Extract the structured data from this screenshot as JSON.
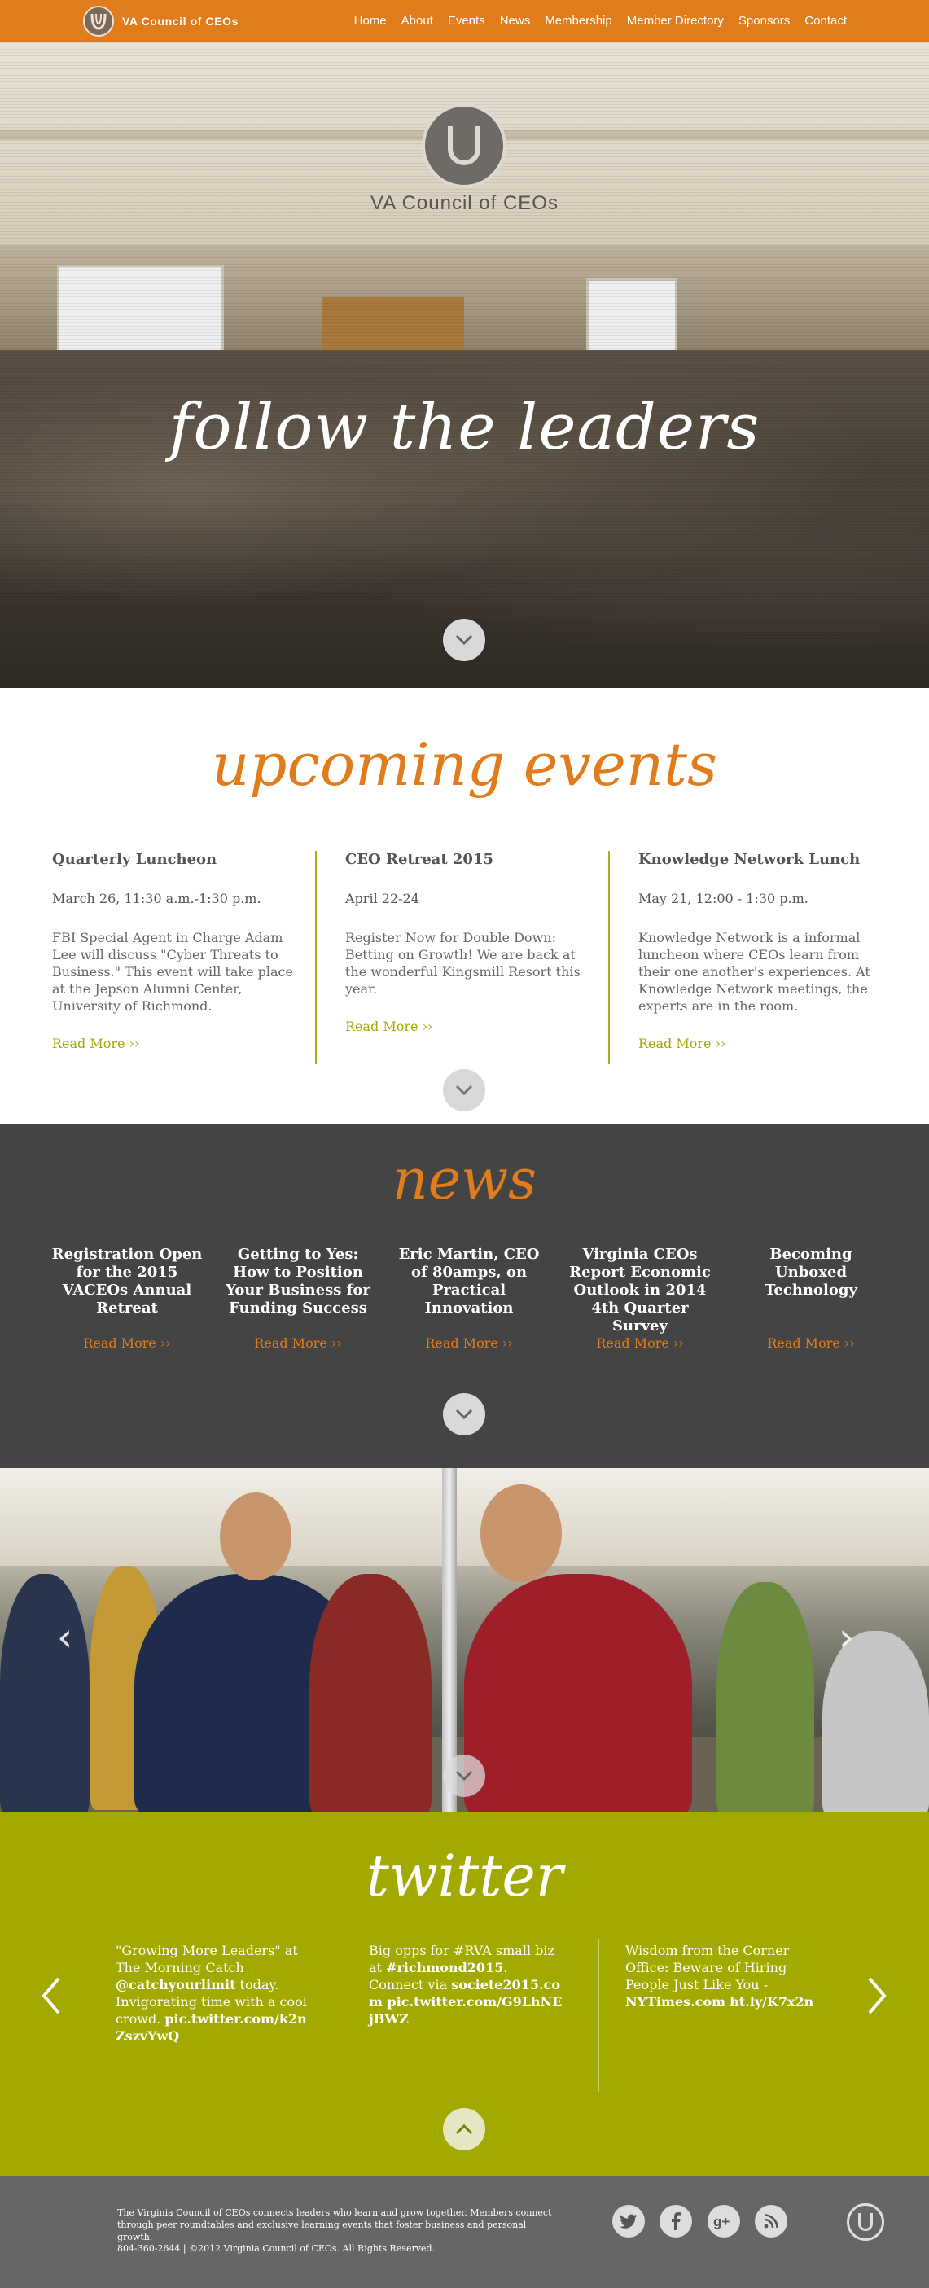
{
  "nav": {
    "brand": "VA Council of CEOs",
    "items": [
      "Home",
      "About",
      "Events",
      "News",
      "Membership",
      "Member Directory",
      "Sponsors",
      "Contact"
    ]
  },
  "hero": {
    "brand": "VA Council of CEOs",
    "tagline": "follow the leaders"
  },
  "events": {
    "title": "upcoming events",
    "items": [
      {
        "title": "Quarterly Luncheon",
        "date": "March 26, 11:30 a.m.-1:30 p.m.",
        "desc": "FBI Special Agent in Charge Adam Lee will discuss \"Cyber Threats to Business.\"  This event will take place at the Jepson Alumni Center, University of Richmond.",
        "more": "Read More ››"
      },
      {
        "title": "CEO Retreat 2015",
        "date": "April 22-24",
        "desc": "Register Now for Double Down: Betting on Growth!  We are back at the wonderful Kingsmill Resort this year.",
        "more": "Read More ››"
      },
      {
        "title": "Knowledge Network Lunch",
        "date": "May 21, 12:00 - 1:30 p.m.",
        "desc": "Knowledge Network is a informal luncheon where CEOs learn from their one another's experiences.  At Knowledge Network meetings, the experts are in the room.",
        "more": "Read More ››"
      }
    ]
  },
  "news": {
    "title": "news",
    "items": [
      {
        "title": "Registration Open for the 2015 VACEOs Annual Retreat",
        "more": "Read More ››"
      },
      {
        "title": "Getting to Yes: How to Position Your Business for Funding Success",
        "more": "Read More ››"
      },
      {
        "title": "Eric Martin, CEO of 80amps, on Practical Innovation",
        "more": "Read More ››"
      },
      {
        "title": "Virginia CEOs Report Economic Outlook in 2014 4th Quarter Survey",
        "more": "Read More ››"
      },
      {
        "title": "Becoming Unboxed Technology",
        "more": "Read More ››"
      }
    ]
  },
  "twitter": {
    "title": "twitter",
    "tweets": [
      {
        "text": "\"Growing More Leaders\" at The Morning Catch ",
        "handle": "@catchyourlimit",
        "text2": " today. Invigorating time with a cool crowd. ",
        "link": "pic.twitter.com/k2nZszvYwQ"
      },
      {
        "text": "Big opps for #RVA small biz at ",
        "handle": "#richmond2015",
        "text2": ". Connect via ",
        "link": "societe2015.com pic.twitter.com/G9LhNEjBWZ"
      },
      {
        "text": "Wisdom from the Corner Office: Beware of Hiring People Just Like You - ",
        "handle": "NYTimes.com",
        "text2": " ",
        "link": "ht.ly/K7x2n"
      }
    ]
  },
  "footer": {
    "about": "The Virginia Council of CEOs connects leaders who learn and grow together. Members connect through peer roundtables and exclusive learning events that foster business and personal growth.",
    "contact": "804-360-2644   |   ©2012 Virginia Council of CEOs. All Rights Reserved.",
    "social": [
      "twitter-icon",
      "facebook-icon",
      "google-plus-icon",
      "rss-icon"
    ]
  },
  "colors": {
    "accent": "#e07c1b",
    "green": "#a2aa00",
    "dark": "#444444"
  }
}
